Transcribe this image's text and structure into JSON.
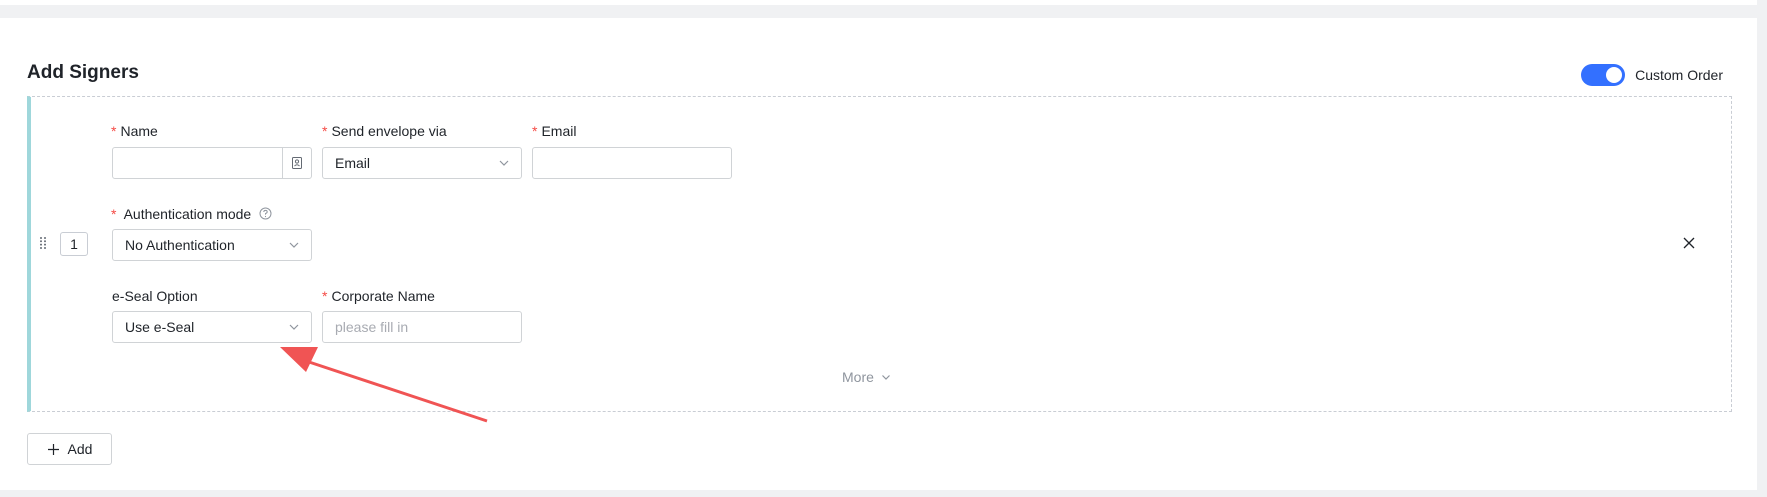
{
  "section": {
    "title": "Add Signers",
    "custom_order_label": "Custom Order",
    "custom_order_on": true
  },
  "signer": {
    "index": "1",
    "required_mark": "*",
    "name": {
      "label": "Name",
      "value": ""
    },
    "send_via": {
      "label": "Send envelope via",
      "value": "Email"
    },
    "email": {
      "label": "Email",
      "value": ""
    },
    "auth_mode": {
      "label": "Authentication mode",
      "value": "No Authentication"
    },
    "eseal": {
      "label": "e-Seal Option",
      "value": "Use e-Seal"
    },
    "corporate": {
      "label": "Corporate Name",
      "value": "",
      "placeholder": "please fill in"
    },
    "more_label": "More"
  },
  "actions": {
    "add_label": "Add"
  },
  "colors": {
    "accent": "#3370ff",
    "required": "#f54a45",
    "left_bar": "#9fd7db",
    "annotation_arrow": "#f05454"
  },
  "icons": {
    "contact": "contact-book-icon",
    "chevron": "chevron-down-icon",
    "help": "question-circle-icon",
    "drag": "drag-handle-icon",
    "close": "close-icon",
    "plus": "plus-icon"
  }
}
